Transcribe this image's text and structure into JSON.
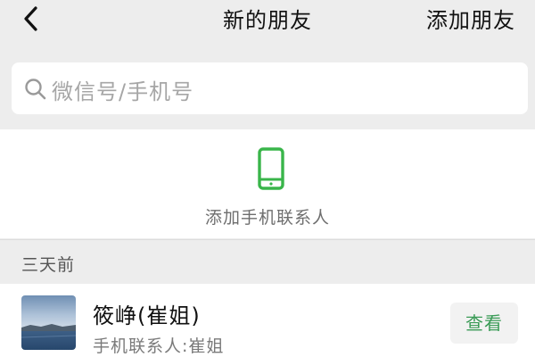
{
  "navbar": {
    "title": "新的朋友",
    "action_label": "添加朋友",
    "back_icon": "chevron-left-icon"
  },
  "search": {
    "placeholder": "微信号/手机号",
    "icon": "search-icon"
  },
  "add_contacts": {
    "label": "添加手机联系人",
    "icon": "mobile-phone-icon",
    "icon_color": "#39b54a"
  },
  "sections": [
    {
      "title": "三天前",
      "items": [
        {
          "name": "筱峥(崔姐)",
          "subtitle": "手机联系人:崔姐",
          "button_label": "查看",
          "avatar": "landscape-lake-photo"
        }
      ]
    }
  ],
  "colors": {
    "background": "#ededed",
    "accent_green": "#39b54a",
    "button_text": "#3a9b56"
  }
}
